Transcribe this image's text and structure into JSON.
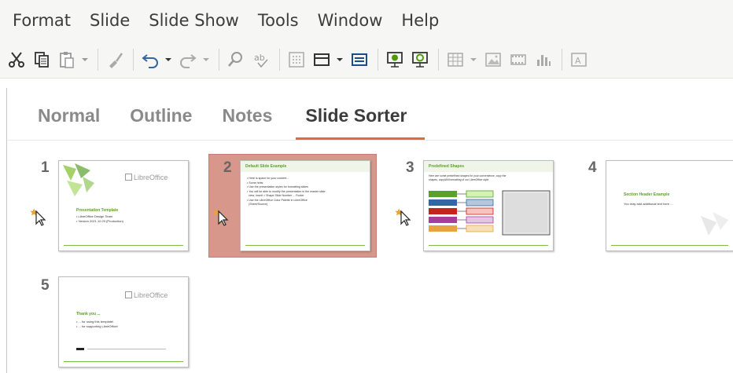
{
  "menu": {
    "items": [
      "Format",
      "Slide",
      "Slide Show",
      "Tools",
      "Window",
      "Help"
    ]
  },
  "toolbar": {
    "icons": [
      "cut-icon",
      "copy-icon",
      "paste-icon",
      "clone-formatting-icon",
      "undo-icon",
      "redo-icon",
      "find-replace-icon",
      "spelling-icon",
      "grid-icon",
      "display-views-icon",
      "master-slide-icon",
      "start-first-slide-icon",
      "start-current-slide-icon",
      "table-icon",
      "image-icon",
      "media-icon",
      "chart-icon"
    ]
  },
  "tabs": [
    {
      "label": "Normal",
      "active": false
    },
    {
      "label": "Outline",
      "active": false
    },
    {
      "label": "Notes",
      "active": false
    },
    {
      "label": "Slide Sorter",
      "active": true
    }
  ],
  "slides": [
    {
      "number": "1",
      "logo": "LibreOffice",
      "title": "Presentation Template",
      "body": "• LibreOffice Design Team\n• Version 2021.10.20 (Production)"
    },
    {
      "number": "2",
      "title": "Default Slide Example",
      "body": "• Here is space for your content...\n• Some hints:\n• Use the presentation styles for formatting slides\n• You will be able to modify the presentation in the master slide\n  view, Insert > Shape Slide Number ... Footer\n• Use the LibreOffice Color Palette in LibreOffice\n  (Sheet/Source)"
    },
    {
      "number": "3",
      "title": "Predefined Shapes",
      "body": "Here are some predefined shapes for your convenience, copy the\nshapes, copy&fill formatting of our LibreOffice style."
    },
    {
      "number": "4",
      "title": "Section Header Example",
      "body": "You may add additional text here ..."
    },
    {
      "number": "5",
      "logo": "LibreOffice",
      "title": "Thank you ...",
      "body": "• ... for using this template!\n• ... for supporting LibreOffice!"
    }
  ],
  "colors": {
    "accent_tab": "#e0693a",
    "selection": "#d7978a",
    "slide_green": "#5aa02c"
  }
}
